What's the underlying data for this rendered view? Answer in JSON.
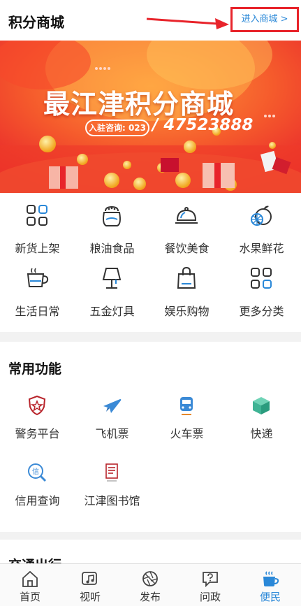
{
  "header": {
    "title": "积分商城",
    "enter_label": "进入商城  >"
  },
  "banner": {
    "brand": "最江津积分商城",
    "pill": "入驻咨询: 023",
    "phone": "/ 47523888"
  },
  "categories": [
    {
      "label": "新货上架",
      "icon": "grid-icon"
    },
    {
      "label": "粮油食品",
      "icon": "rice-bag-icon"
    },
    {
      "label": "餐饮美食",
      "icon": "food-cloche-icon"
    },
    {
      "label": "水果鲜花",
      "icon": "fruit-icon"
    },
    {
      "label": "生活日常",
      "icon": "cup-icon"
    },
    {
      "label": "五金灯具",
      "icon": "lamp-icon"
    },
    {
      "label": "娱乐购物",
      "icon": "shopping-bag-icon"
    },
    {
      "label": "更多分类",
      "icon": "more-grid-icon"
    }
  ],
  "common": {
    "title": "常用功能",
    "items": [
      {
        "label": "警务平台",
        "icon": "police-badge-icon"
      },
      {
        "label": "飞机票",
        "icon": "airplane-icon"
      },
      {
        "label": "火车票",
        "icon": "train-icon"
      },
      {
        "label": "快递",
        "icon": "package-icon"
      },
      {
        "label": "信用查询",
        "icon": "credit-search-icon"
      },
      {
        "label": "江津图书馆",
        "icon": "library-icon"
      }
    ]
  },
  "traffic": {
    "title": "交通出行"
  },
  "nav": {
    "items": [
      {
        "label": "首页",
        "icon": "home-icon"
      },
      {
        "label": "视听",
        "icon": "music-icon"
      },
      {
        "label": "发布",
        "icon": "camera-shutter-icon"
      },
      {
        "label": "问政",
        "icon": "question-chat-icon"
      },
      {
        "label": "便民",
        "icon": "coffee-cup-icon"
      }
    ],
    "active_index": 4
  },
  "colors": {
    "accent": "#2a88d8",
    "highlight_box": "#e8242b",
    "banner_red": "#f0452a"
  }
}
